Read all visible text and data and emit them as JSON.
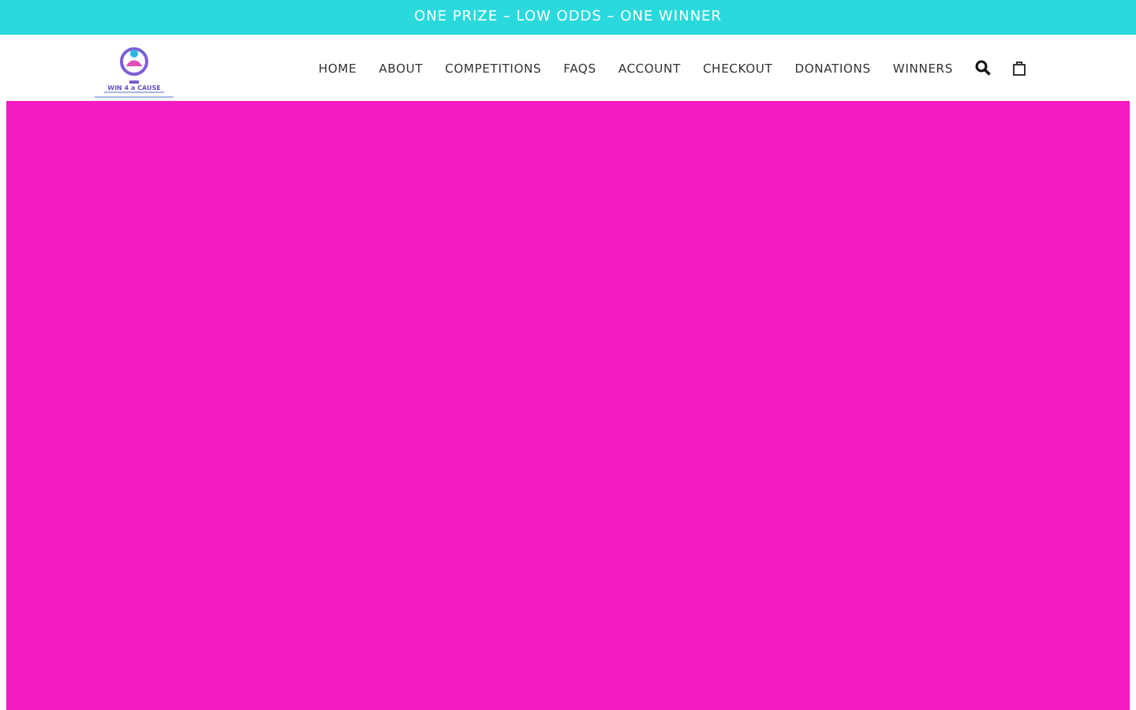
{
  "announcement": "ONE PRIZE – LOW ODDS – ONE WINNER",
  "logo": {
    "text": "WIN 4 a CAUSE"
  },
  "nav": [
    {
      "label": "HOME"
    },
    {
      "label": "ABOUT"
    },
    {
      "label": "COMPETITIONS"
    },
    {
      "label": "FAQS"
    },
    {
      "label": "ACCOUNT"
    },
    {
      "label": "CHECKOUT"
    },
    {
      "label": "DONATIONS"
    },
    {
      "label": "WINNERS"
    }
  ]
}
